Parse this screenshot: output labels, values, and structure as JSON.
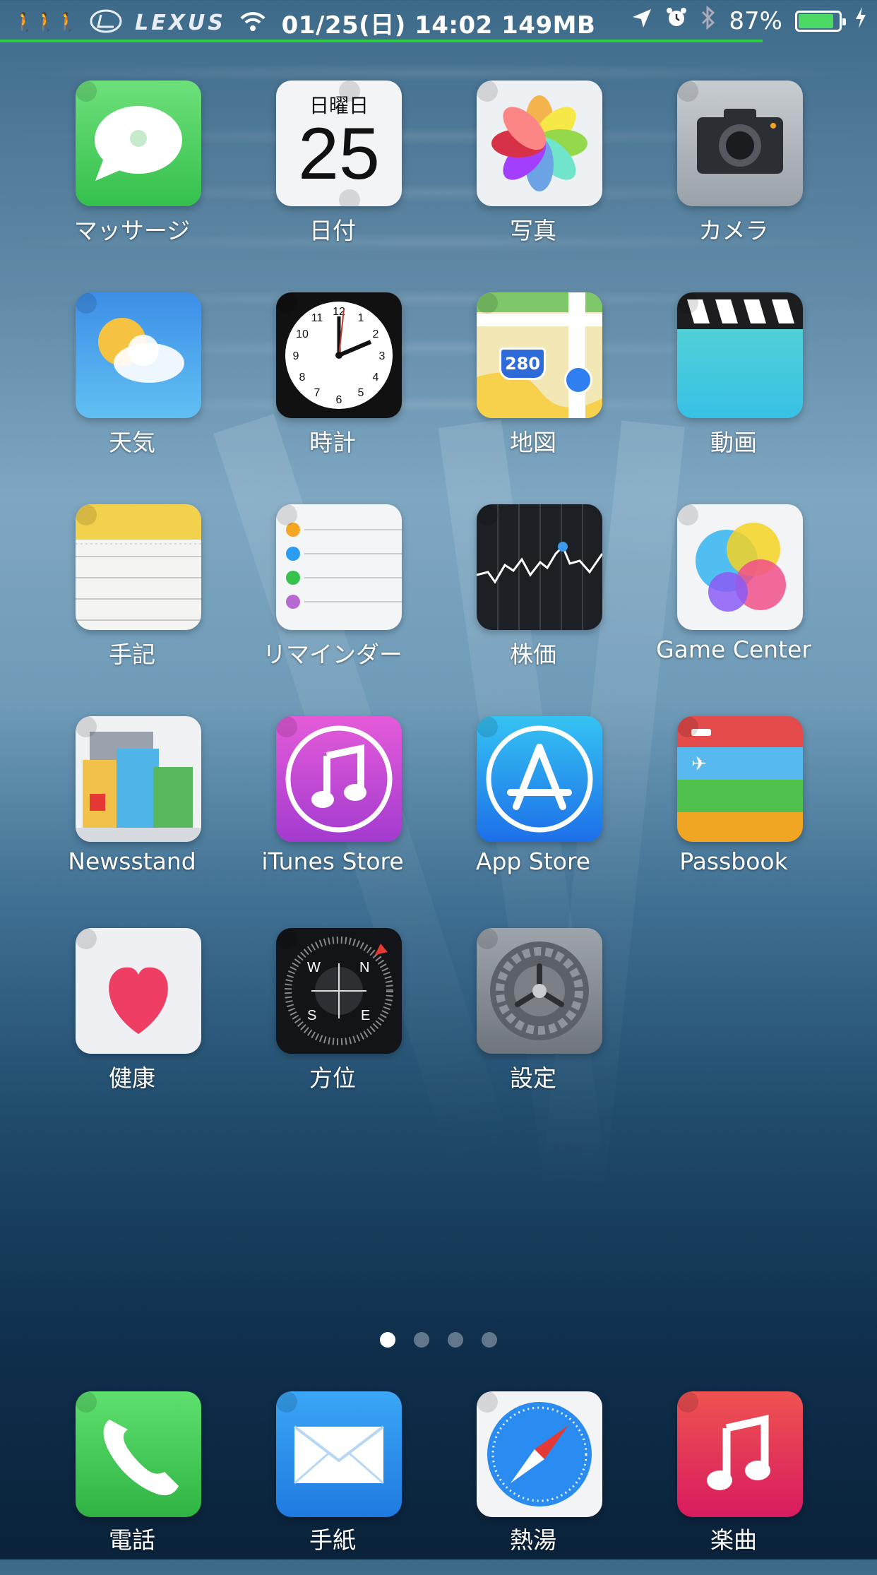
{
  "status_bar": {
    "carrier": "LEXUS",
    "datetime_memory": "01/25(日) 14:02 149MB",
    "battery_percent": "87%",
    "battery_level": 0.87,
    "icons": [
      "evolution-icon",
      "lexus-logo-icon",
      "wifi-icon",
      "location-arrow-icon",
      "alarm-icon",
      "bluetooth-icon",
      "battery-icon",
      "charging-bolt-icon"
    ]
  },
  "apps": [
    {
      "label": "マッサージ",
      "icon": "messages-icon"
    },
    {
      "label": "日付",
      "icon": "calendar-icon",
      "weekday": "日曜日",
      "day": "25"
    },
    {
      "label": "写真",
      "icon": "photos-icon"
    },
    {
      "label": "カメラ",
      "icon": "camera-icon"
    },
    {
      "label": "天気",
      "icon": "weather-icon"
    },
    {
      "label": "時計",
      "icon": "clock-icon"
    },
    {
      "label": "地図",
      "icon": "maps-icon",
      "road": "280"
    },
    {
      "label": "動画",
      "icon": "videos-icon"
    },
    {
      "label": "手記",
      "icon": "notes-icon"
    },
    {
      "label": "リマインダー",
      "icon": "reminders-icon"
    },
    {
      "label": "株価",
      "icon": "stocks-icon"
    },
    {
      "label": "Game Center",
      "icon": "game-center-icon"
    },
    {
      "label": "Newsstand",
      "icon": "newsstand-icon"
    },
    {
      "label": "iTunes Store",
      "icon": "itunes-store-icon"
    },
    {
      "label": "App Store",
      "icon": "app-store-icon"
    },
    {
      "label": "Passbook",
      "icon": "passbook-icon"
    },
    {
      "label": "健康",
      "icon": "health-icon"
    },
    {
      "label": "方位",
      "icon": "compass-icon"
    },
    {
      "label": "設定",
      "icon": "settings-icon"
    }
  ],
  "page_indicator": {
    "pages": 4,
    "current": 1
  },
  "dock": [
    {
      "label": "電話",
      "icon": "phone-icon"
    },
    {
      "label": "手紙",
      "icon": "mail-icon"
    },
    {
      "label": "熱湯",
      "icon": "safari-icon"
    },
    {
      "label": "楽曲",
      "icon": "music-icon"
    }
  ],
  "colors": {
    "battery": "#4cd964",
    "progress": "#2ecc40"
  }
}
